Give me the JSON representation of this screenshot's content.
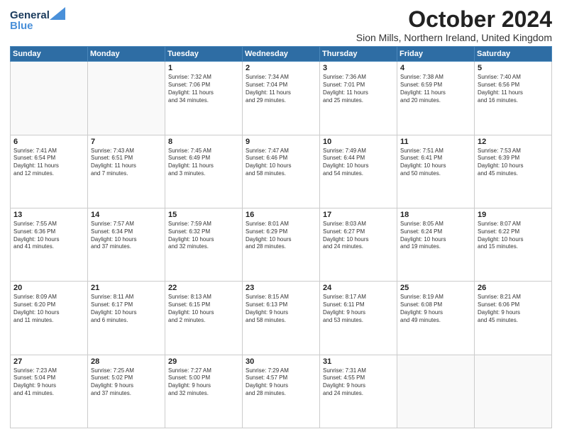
{
  "logo": {
    "general": "General",
    "blue": "Blue"
  },
  "header": {
    "month_title": "October 2024",
    "location": "Sion Mills, Northern Ireland, United Kingdom"
  },
  "weekdays": [
    "Sunday",
    "Monday",
    "Tuesday",
    "Wednesday",
    "Thursday",
    "Friday",
    "Saturday"
  ],
  "weeks": [
    [
      {
        "day": "",
        "info": ""
      },
      {
        "day": "",
        "info": ""
      },
      {
        "day": "1",
        "info": "Sunrise: 7:32 AM\nSunset: 7:06 PM\nDaylight: 11 hours\nand 34 minutes."
      },
      {
        "day": "2",
        "info": "Sunrise: 7:34 AM\nSunset: 7:04 PM\nDaylight: 11 hours\nand 29 minutes."
      },
      {
        "day": "3",
        "info": "Sunrise: 7:36 AM\nSunset: 7:01 PM\nDaylight: 11 hours\nand 25 minutes."
      },
      {
        "day": "4",
        "info": "Sunrise: 7:38 AM\nSunset: 6:59 PM\nDaylight: 11 hours\nand 20 minutes."
      },
      {
        "day": "5",
        "info": "Sunrise: 7:40 AM\nSunset: 6:56 PM\nDaylight: 11 hours\nand 16 minutes."
      }
    ],
    [
      {
        "day": "6",
        "info": "Sunrise: 7:41 AM\nSunset: 6:54 PM\nDaylight: 11 hours\nand 12 minutes."
      },
      {
        "day": "7",
        "info": "Sunrise: 7:43 AM\nSunset: 6:51 PM\nDaylight: 11 hours\nand 7 minutes."
      },
      {
        "day": "8",
        "info": "Sunrise: 7:45 AM\nSunset: 6:49 PM\nDaylight: 11 hours\nand 3 minutes."
      },
      {
        "day": "9",
        "info": "Sunrise: 7:47 AM\nSunset: 6:46 PM\nDaylight: 10 hours\nand 58 minutes."
      },
      {
        "day": "10",
        "info": "Sunrise: 7:49 AM\nSunset: 6:44 PM\nDaylight: 10 hours\nand 54 minutes."
      },
      {
        "day": "11",
        "info": "Sunrise: 7:51 AM\nSunset: 6:41 PM\nDaylight: 10 hours\nand 50 minutes."
      },
      {
        "day": "12",
        "info": "Sunrise: 7:53 AM\nSunset: 6:39 PM\nDaylight: 10 hours\nand 45 minutes."
      }
    ],
    [
      {
        "day": "13",
        "info": "Sunrise: 7:55 AM\nSunset: 6:36 PM\nDaylight: 10 hours\nand 41 minutes."
      },
      {
        "day": "14",
        "info": "Sunrise: 7:57 AM\nSunset: 6:34 PM\nDaylight: 10 hours\nand 37 minutes."
      },
      {
        "day": "15",
        "info": "Sunrise: 7:59 AM\nSunset: 6:32 PM\nDaylight: 10 hours\nand 32 minutes."
      },
      {
        "day": "16",
        "info": "Sunrise: 8:01 AM\nSunset: 6:29 PM\nDaylight: 10 hours\nand 28 minutes."
      },
      {
        "day": "17",
        "info": "Sunrise: 8:03 AM\nSunset: 6:27 PM\nDaylight: 10 hours\nand 24 minutes."
      },
      {
        "day": "18",
        "info": "Sunrise: 8:05 AM\nSunset: 6:24 PM\nDaylight: 10 hours\nand 19 minutes."
      },
      {
        "day": "19",
        "info": "Sunrise: 8:07 AM\nSunset: 6:22 PM\nDaylight: 10 hours\nand 15 minutes."
      }
    ],
    [
      {
        "day": "20",
        "info": "Sunrise: 8:09 AM\nSunset: 6:20 PM\nDaylight: 10 hours\nand 11 minutes."
      },
      {
        "day": "21",
        "info": "Sunrise: 8:11 AM\nSunset: 6:17 PM\nDaylight: 10 hours\nand 6 minutes."
      },
      {
        "day": "22",
        "info": "Sunrise: 8:13 AM\nSunset: 6:15 PM\nDaylight: 10 hours\nand 2 minutes."
      },
      {
        "day": "23",
        "info": "Sunrise: 8:15 AM\nSunset: 6:13 PM\nDaylight: 9 hours\nand 58 minutes."
      },
      {
        "day": "24",
        "info": "Sunrise: 8:17 AM\nSunset: 6:11 PM\nDaylight: 9 hours\nand 53 minutes."
      },
      {
        "day": "25",
        "info": "Sunrise: 8:19 AM\nSunset: 6:08 PM\nDaylight: 9 hours\nand 49 minutes."
      },
      {
        "day": "26",
        "info": "Sunrise: 8:21 AM\nSunset: 6:06 PM\nDaylight: 9 hours\nand 45 minutes."
      }
    ],
    [
      {
        "day": "27",
        "info": "Sunrise: 7:23 AM\nSunset: 5:04 PM\nDaylight: 9 hours\nand 41 minutes."
      },
      {
        "day": "28",
        "info": "Sunrise: 7:25 AM\nSunset: 5:02 PM\nDaylight: 9 hours\nand 37 minutes."
      },
      {
        "day": "29",
        "info": "Sunrise: 7:27 AM\nSunset: 5:00 PM\nDaylight: 9 hours\nand 32 minutes."
      },
      {
        "day": "30",
        "info": "Sunrise: 7:29 AM\nSunset: 4:57 PM\nDaylight: 9 hours\nand 28 minutes."
      },
      {
        "day": "31",
        "info": "Sunrise: 7:31 AM\nSunset: 4:55 PM\nDaylight: 9 hours\nand 24 minutes."
      },
      {
        "day": "",
        "info": ""
      },
      {
        "day": "",
        "info": ""
      }
    ]
  ]
}
